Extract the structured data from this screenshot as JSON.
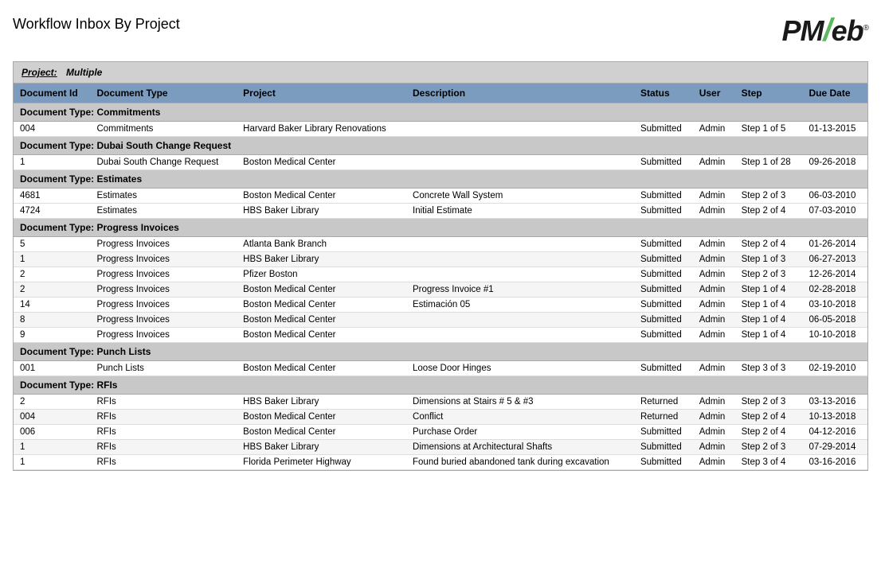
{
  "page": {
    "title": "Workflow Inbox By Project"
  },
  "logo": {
    "part1": "PM",
    "slash": "/",
    "part2": "eb",
    "registered": "®"
  },
  "project_filter": {
    "label": "Project:",
    "value": "Multiple"
  },
  "table": {
    "columns": [
      "Document Id",
      "Document Type",
      "Project",
      "Description",
      "Status",
      "User",
      "Step",
      "Due Date"
    ],
    "sections": [
      {
        "section_label": "Document Type:  Commitments",
        "rows": [
          {
            "doc_id": "004",
            "doc_type": "Commitments",
            "project": "Harvard Baker Library Renovations",
            "description": "",
            "status": "Submitted",
            "user": "Admin",
            "step": "Step 1 of 5",
            "due_date": "01-13-2015"
          }
        ]
      },
      {
        "section_label": "Document Type:  Dubai South Change Request",
        "rows": [
          {
            "doc_id": "1",
            "doc_type": "Dubai South Change Request",
            "project": "Boston Medical Center",
            "description": "",
            "status": "Submitted",
            "user": "Admin",
            "step": "Step 1 of 28",
            "due_date": "09-26-2018"
          }
        ]
      },
      {
        "section_label": "Document Type:  Estimates",
        "rows": [
          {
            "doc_id": "4681",
            "doc_type": "Estimates",
            "project": "Boston Medical Center",
            "description": "Concrete Wall System",
            "status": "Submitted",
            "user": "Admin",
            "step": "Step 2 of 3",
            "due_date": "06-03-2010"
          },
          {
            "doc_id": "4724",
            "doc_type": "Estimates",
            "project": "HBS Baker Library",
            "description": "Initial Estimate",
            "status": "Submitted",
            "user": "Admin",
            "step": "Step 2 of 4",
            "due_date": "07-03-2010"
          }
        ]
      },
      {
        "section_label": "Document Type:  Progress Invoices",
        "rows": [
          {
            "doc_id": "5",
            "doc_type": "Progress Invoices",
            "project": "Atlanta Bank Branch",
            "description": "",
            "status": "Submitted",
            "user": "Admin",
            "step": "Step 2 of 4",
            "due_date": "01-26-2014"
          },
          {
            "doc_id": "1",
            "doc_type": "Progress Invoices",
            "project": "HBS Baker Library",
            "description": "",
            "status": "Submitted",
            "user": "Admin",
            "step": "Step 1 of 3",
            "due_date": "06-27-2013"
          },
          {
            "doc_id": "2",
            "doc_type": "Progress Invoices",
            "project": "Pfizer Boston",
            "description": "",
            "status": "Submitted",
            "user": "Admin",
            "step": "Step 2 of 3",
            "due_date": "12-26-2014"
          },
          {
            "doc_id": "2",
            "doc_type": "Progress Invoices",
            "project": "Boston Medical Center",
            "description": "Progress Invoice #1",
            "status": "Submitted",
            "user": "Admin",
            "step": "Step 1 of 4",
            "due_date": "02-28-2018"
          },
          {
            "doc_id": "14",
            "doc_type": "Progress Invoices",
            "project": "Boston Medical Center",
            "description": "Estimación 05",
            "status": "Submitted",
            "user": "Admin",
            "step": "Step 1 of 4",
            "due_date": "03-10-2018"
          },
          {
            "doc_id": "8",
            "doc_type": "Progress Invoices",
            "project": "Boston Medical Center",
            "description": "",
            "status": "Submitted",
            "user": "Admin",
            "step": "Step 1 of 4",
            "due_date": "06-05-2018"
          },
          {
            "doc_id": "9",
            "doc_type": "Progress Invoices",
            "project": "Boston Medical Center",
            "description": "",
            "status": "Submitted",
            "user": "Admin",
            "step": "Step 1 of 4",
            "due_date": "10-10-2018"
          }
        ]
      },
      {
        "section_label": "Document Type:  Punch Lists",
        "rows": [
          {
            "doc_id": "001",
            "doc_type": "Punch Lists",
            "project": "Boston Medical Center",
            "description": "Loose Door Hinges",
            "status": "Submitted",
            "user": "Admin",
            "step": "Step 3 of 3",
            "due_date": "02-19-2010"
          }
        ]
      },
      {
        "section_label": "Document Type:  RFIs",
        "rows": [
          {
            "doc_id": "2",
            "doc_type": "RFIs",
            "project": "HBS Baker Library",
            "description": "Dimensions at Stairs # 5 & #3",
            "status": "Returned",
            "user": "Admin",
            "step": "Step 2 of 3",
            "due_date": "03-13-2016"
          },
          {
            "doc_id": "004",
            "doc_type": "RFIs",
            "project": "Boston Medical Center",
            "description": "Conflict",
            "status": "Returned",
            "user": "Admin",
            "step": "Step 2 of 4",
            "due_date": "10-13-2018"
          },
          {
            "doc_id": "006",
            "doc_type": "RFIs",
            "project": "Boston Medical Center",
            "description": "Purchase Order",
            "status": "Submitted",
            "user": "Admin",
            "step": "Step 2 of 4",
            "due_date": "04-12-2016"
          },
          {
            "doc_id": "1",
            "doc_type": "RFIs",
            "project": "HBS Baker Library",
            "description": "Dimensions at Architectural Shafts",
            "status": "Submitted",
            "user": "Admin",
            "step": "Step 2 of 3",
            "due_date": "07-29-2014"
          },
          {
            "doc_id": "1",
            "doc_type": "RFIs",
            "project": "Florida Perimeter Highway",
            "description": "Found buried abandoned tank during excavation",
            "status": "Submitted",
            "user": "Admin",
            "step": "Step 3 of 4",
            "due_date": "03-16-2016"
          }
        ]
      }
    ]
  }
}
